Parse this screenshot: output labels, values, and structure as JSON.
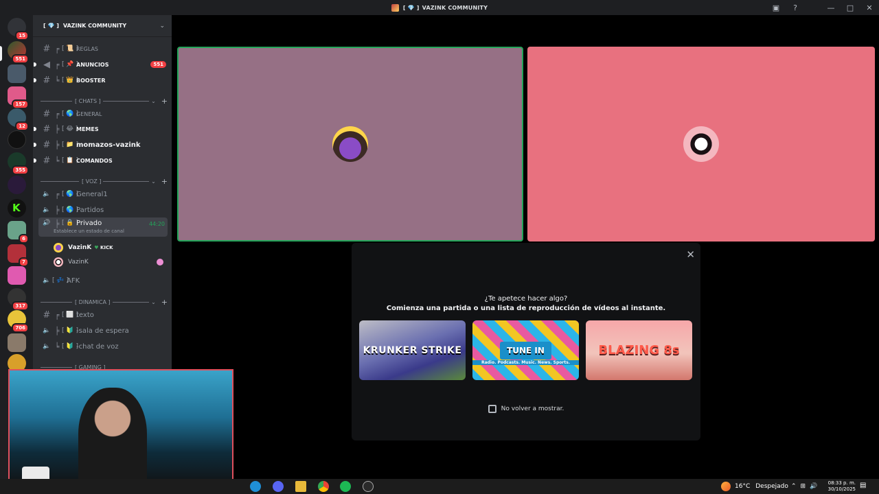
{
  "window": {
    "title": "VAZINK COMMUNITY",
    "title_prefix": "[ 💎 ]"
  },
  "rail": {
    "servers": [
      {
        "icon": "discord-home-icon",
        "badge": "15"
      },
      {
        "icon": "server-icon",
        "badge": "551"
      },
      {
        "icon": "squad-server-icon",
        "badge": ""
      },
      {
        "icon": "server-icon",
        "badge": "157"
      },
      {
        "icon": "server-icon",
        "badge": "12"
      },
      {
        "icon": "tiktok-server-icon",
        "badge": ""
      },
      {
        "icon": "server-icon",
        "badge": "355"
      },
      {
        "icon": "server-icon",
        "badge": ""
      },
      {
        "icon": "kick-server-icon",
        "badge": ""
      },
      {
        "icon": "server-icon",
        "badge": "6"
      },
      {
        "icon": "server-icon",
        "badge": "7"
      },
      {
        "icon": "server-icon",
        "badge": ""
      },
      {
        "icon": "server-icon",
        "badge": "317"
      },
      {
        "icon": "server-icon",
        "badge": "706"
      },
      {
        "icon": "server-icon",
        "badge": ""
      },
      {
        "icon": "server-icon",
        "badge": ""
      }
    ]
  },
  "sidebar": {
    "guild_name": "VAZINK COMMUNITY",
    "guild_prefix": "[ 💎 ]",
    "channels": {
      "reglas": {
        "emoji": "[ 📜 ]",
        "name": "REGLAS"
      },
      "anuncios": {
        "emoji": "[ 📌 ]",
        "name": "ANUNCIOS",
        "count": "551"
      },
      "booster": {
        "emoji": "[ 👑 ]",
        "name": "BOOSTER"
      },
      "general": {
        "emoji": "[ 🌎 ]",
        "name": "GENERAL"
      },
      "memes": {
        "emoji": "[ 😂 ]",
        "name": "MEMES"
      },
      "momazos": {
        "emoji": "[ 📁 ]",
        "name": "momazos-vazink"
      },
      "comandos": {
        "emoji": "[ 📋 ]",
        "name": "COMANDOS"
      },
      "general1": {
        "emoji": "[ 🌎 ]",
        "name": "General1"
      },
      "partidos": {
        "emoji": "[ 🌎 ]",
        "name": "Partidos"
      },
      "privado": {
        "emoji": "[ 🔒 ]",
        "name": "Privado",
        "timer": "44:20",
        "status": "Establece un estado de canal"
      },
      "afk": {
        "emoji": "[ 💤 ]",
        "name": "AFK"
      },
      "texto": {
        "emoji": "[ ⬜ ]",
        "name": "texto"
      },
      "sala_espera": {
        "emoji": "[ 🔰 ]",
        "name": "-sala de espera"
      },
      "chat_voz": {
        "emoji": "[ 🔰 ]",
        "name": "-chat de voz"
      }
    },
    "categories": {
      "chats": "[ CHATS ]",
      "voz": "[ VOZ ]",
      "dinamica": "[ DINAMICA ]",
      "gaming": "[ GAMING ]"
    },
    "voice_users": [
      {
        "name": "VazinK",
        "tag": "KICK"
      },
      {
        "name": "VazinK",
        "tag": ""
      }
    ]
  },
  "stage": {
    "activity": {
      "heading": "¿Te apetece hacer algo?",
      "subheading": "Comienza una partida o una lista de reproducción de vídeos al instante.",
      "cards": [
        {
          "title": "KRUNKER STRIKE"
        },
        {
          "title": "TUNE IN",
          "subtitle": "Radio. Podcasts. Music. News. Sports."
        },
        {
          "title": "BLAZING 8s"
        }
      ],
      "checkbox_label": "No volver a mostrar."
    }
  },
  "taskbar": {
    "temperature": "16°C",
    "weather": "Despejado",
    "time": "08:33 p. m.",
    "date": "30/10/2025"
  }
}
